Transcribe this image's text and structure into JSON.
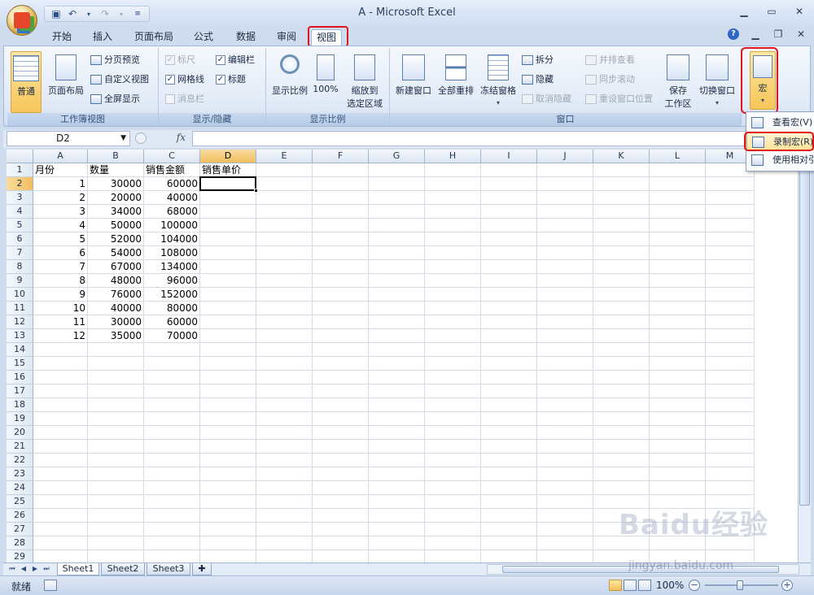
{
  "window": {
    "title": "A - Microsoft Excel"
  },
  "tabs": [
    "开始",
    "插入",
    "页面布局",
    "公式",
    "数据",
    "审阅",
    "视图"
  ],
  "active_tab": "视图",
  "ribbon": {
    "workbook_views": {
      "label": "工作簿视图",
      "normal": "普通",
      "page_layout": "页面布局",
      "page_break_preview": "分页预览",
      "custom_views": "自定义视图",
      "full_screen": "全屏显示"
    },
    "show_hide": {
      "label": "显示/隐藏",
      "ruler": "标尺",
      "formula_bar": "编辑栏",
      "gridlines": "网格线",
      "headings": "标题",
      "message_bar": "消息栏",
      "check": "✓"
    },
    "zoom": {
      "label": "显示比例",
      "zoom_btn": "显示比例",
      "hundred": "100%",
      "fit_selection_line1": "缩放到",
      "fit_selection_line2": "选定区域"
    },
    "window": {
      "label": "窗口",
      "new_window": "新建窗口",
      "arrange_all": "全部重排",
      "freeze_panes": "冻结窗格",
      "split": "拆分",
      "hide": "隐藏",
      "unhide": "取消隐藏",
      "side_by_side": "并排查看",
      "sync_scroll": "同步滚动",
      "reset_position": "重设窗口位置",
      "save_workspace_line1": "保存",
      "save_workspace_line2": "工作区",
      "switch_windows": "切换窗口"
    },
    "macros": {
      "label": "宏"
    }
  },
  "macro_menu": [
    "查看宏(V)",
    "录制宏(R)",
    "使用相对引用"
  ],
  "formula_bar": {
    "name_box": "D2",
    "fx": "fx",
    "value": ""
  },
  "grid": {
    "columns": [
      "A",
      "B",
      "C",
      "D",
      "E",
      "F",
      "G",
      "H",
      "I",
      "J",
      "K",
      "L",
      "M"
    ],
    "row_numbers": [
      "1",
      "2",
      "3",
      "4",
      "5",
      "6",
      "7",
      "8",
      "9",
      "10",
      "11",
      "12",
      "13",
      "14",
      "15",
      "16",
      "17",
      "18",
      "19",
      "20",
      "21",
      "22",
      "23",
      "24",
      "25",
      "26",
      "27",
      "28",
      "29"
    ],
    "header_row": [
      "月份",
      "数量",
      "销售金额",
      "销售单价"
    ],
    "rows": [
      [
        "1",
        "30000",
        "60000"
      ],
      [
        "2",
        "20000",
        "40000"
      ],
      [
        "3",
        "34000",
        "68000"
      ],
      [
        "4",
        "50000",
        "100000"
      ],
      [
        "5",
        "52000",
        "104000"
      ],
      [
        "6",
        "54000",
        "108000"
      ],
      [
        "7",
        "67000",
        "134000"
      ],
      [
        "8",
        "48000",
        "96000"
      ],
      [
        "9",
        "76000",
        "152000"
      ],
      [
        "10",
        "40000",
        "80000"
      ],
      [
        "11",
        "30000",
        "60000"
      ],
      [
        "12",
        "35000",
        "70000"
      ]
    ],
    "active_cell": "D2"
  },
  "sheets": [
    "Sheet1",
    "Sheet2",
    "Sheet3"
  ],
  "status": {
    "text": "就绪",
    "zoom": "100%"
  },
  "watermark": {
    "brand": "Baidu经验",
    "url": "jingyan.baidu.com"
  },
  "colors": {
    "highlight": "#e0141f",
    "ribbon_bg": "#e4ecf8",
    "active_header": "#f2bd5e"
  }
}
